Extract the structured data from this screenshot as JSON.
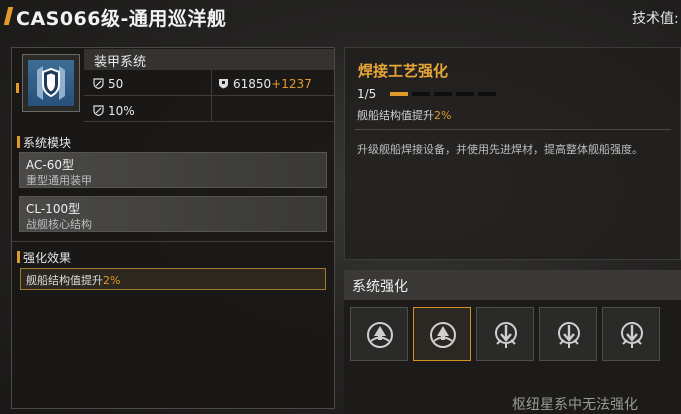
{
  "header": {
    "title": "CAS066级-通用巡洋舰",
    "tech_label": "技术值:"
  },
  "armor": {
    "title": "装甲系统",
    "stats": {
      "stat1": "50",
      "stat2_base": "61850",
      "stat2_bonus": "+1237",
      "stat3": "10%"
    }
  },
  "modules_section": {
    "label": "系统模块",
    "items": [
      {
        "name": "AC-60型",
        "desc": "重型通用装甲"
      },
      {
        "name": "CL-100型",
        "desc": "战舰核心结构"
      }
    ]
  },
  "effect_section": {
    "label": "强化效果",
    "text": "舰船结构值提升",
    "pct": "2%"
  },
  "detail": {
    "title": "焊接工艺强化",
    "level": "1/5",
    "level_current": 1,
    "level_max": 5,
    "effect_text": "舰船结构值提升",
    "effect_pct": "2%",
    "description": "升级舰船焊接设备，并使用先进焊材，提高整体舰船强度。"
  },
  "system_enhance": {
    "title": "系统强化",
    "slots": [
      {
        "icon": "emblem-up-icon",
        "selected": false
      },
      {
        "icon": "emblem-up-icon",
        "selected": true
      },
      {
        "icon": "arrow-down-burst-icon",
        "selected": false
      },
      {
        "icon": "arrow-down-burst-icon",
        "selected": false
      },
      {
        "icon": "arrow-down-burst-icon",
        "selected": false
      }
    ],
    "notice": "枢纽星系中无法强化"
  },
  "colors": {
    "accent": "#e09a2a",
    "armor_icon": "#3d6d96"
  }
}
